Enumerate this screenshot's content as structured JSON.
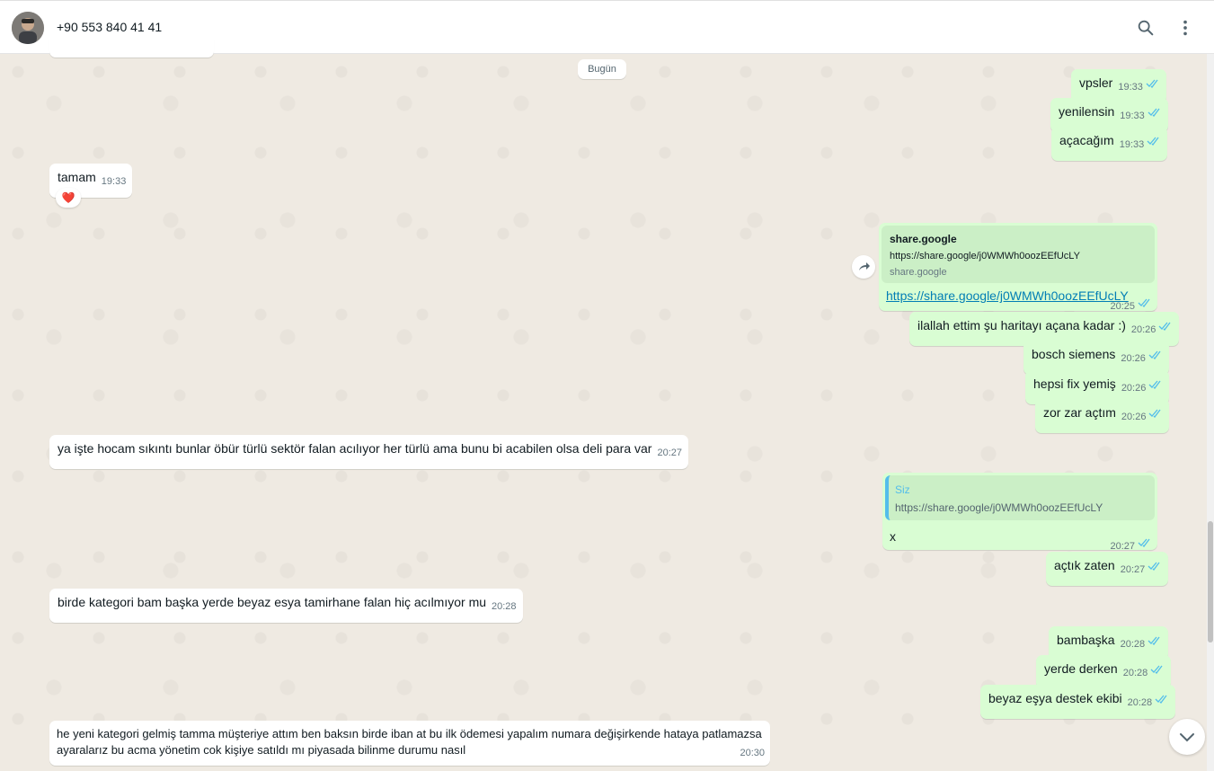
{
  "header": {
    "contact_name": "+90 553 840 41 41",
    "icons": [
      "avatar",
      "search-icon",
      "menu-icon"
    ]
  },
  "chat": {
    "date_label": "Bugün",
    "messages": [
      {
        "dir": "out",
        "text": "vpsler",
        "time": "19:33"
      },
      {
        "dir": "out",
        "text": "yenilensin",
        "time": "19:33"
      },
      {
        "dir": "out",
        "text": "açacağım",
        "time": "19:33"
      },
      {
        "dir": "in",
        "text": "tamam",
        "time": "19:33",
        "reaction": "❤️"
      },
      {
        "dir": "out",
        "preview_title": "share.google",
        "preview_url": "https://share.google/j0WMWh0oozEEfUcLY",
        "preview_domain": "share.google",
        "text": "https://share.google/j0WMWh0oozEEfUcLY",
        "time": "20:25"
      },
      {
        "dir": "out",
        "text": "ilallah ettim şu haritayı açana kadar :)",
        "time": "20:26"
      },
      {
        "dir": "out",
        "text": "bosch siemens",
        "time": "20:26"
      },
      {
        "dir": "out",
        "text": "hepsi fix yemiş",
        "time": "20:26"
      },
      {
        "dir": "out",
        "text": "zor zar açtım",
        "time": "20:26"
      },
      {
        "dir": "in",
        "text": "ya işte hocam sıkıntı bunlar öbür türlü sektör falan acılıyor her türlü ama bunu bi acabilen olsa  deli para var",
        "time": "20:27"
      },
      {
        "dir": "out",
        "quote_author": "Siz",
        "quote_text": "https://share.google/j0WMWh0oozEEfUcLY",
        "text": "x",
        "time": "20:27"
      },
      {
        "dir": "out",
        "text": "açtık zaten",
        "time": "20:27"
      },
      {
        "dir": "in",
        "text": "birde kategori bam başka yerde  beyaz esya tamirhane falan hiç acılmıyor mu",
        "time": "20:28"
      },
      {
        "dir": "out",
        "text": "bambaşka",
        "time": "20:28"
      },
      {
        "dir": "out",
        "text": "yerde derken",
        "time": "20:28"
      },
      {
        "dir": "out",
        "text": "beyaz eşya destek ekibi",
        "time": "20:28"
      },
      {
        "dir": "in",
        "text": "he yeni kategori gelmiş tamma müşteriye attım ben baksın birde iban at bu ilk ödemesi yapalım numara değişirkende hataya patlamazsa ayaralarız bu acma yönetim cok kişiye satıldı mı piyasada bilinme durumu nasıl",
        "time": "20:30"
      }
    ]
  },
  "colors": {
    "outgoing_bubble": "#d9fdd3",
    "incoming_bubble": "#ffffff",
    "chat_background": "#efeae2",
    "read_tick": "#53bdeb",
    "link": "#027eb5"
  }
}
